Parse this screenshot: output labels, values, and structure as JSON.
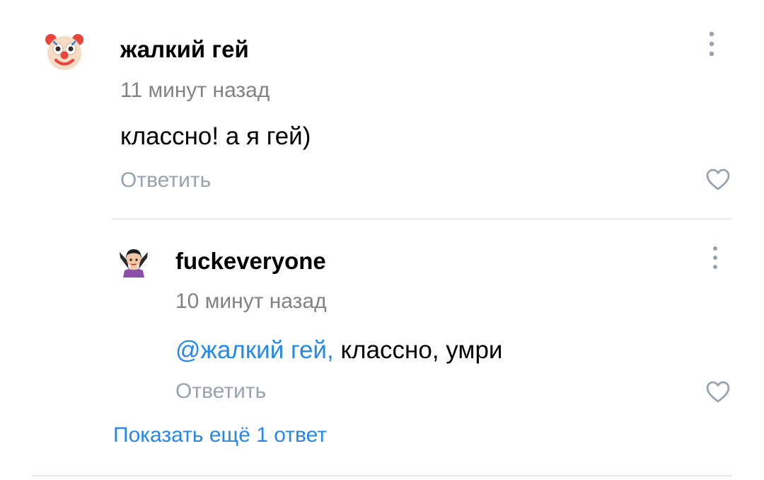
{
  "comment": {
    "avatar_icon": "clown-face-icon",
    "author": "жалкий гей",
    "time": "11 минут назад",
    "text": "классно! а я гей)",
    "reply_label": "Ответить"
  },
  "reply": {
    "avatar_icon": "vampire-woman-icon",
    "author": "fuckeveryone",
    "time": "10 минут назад",
    "mention": "@жалкий гей,",
    "text": " классно, умри",
    "reply_label": "Ответить"
  },
  "show_more_label": "Показать ещё 1 ответ",
  "colors": {
    "link": "#2688eb",
    "secondary_text": "#828282",
    "action_text": "#99a2ad",
    "icon": "#99a2ad",
    "divider": "#e5e7eb"
  }
}
